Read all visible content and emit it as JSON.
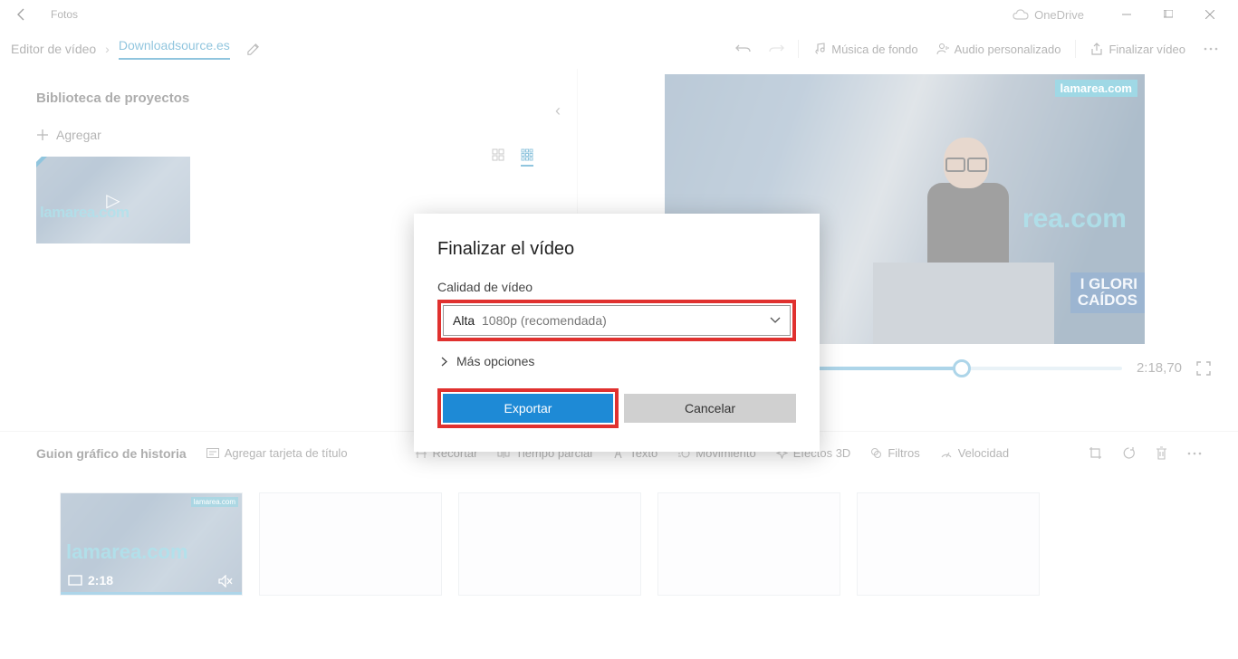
{
  "app_title": "Fotos",
  "onedrive": "OneDrive",
  "breadcrumb": {
    "root": "Editor de vídeo",
    "project": "Downloadsource.es"
  },
  "toolbar": {
    "bg_music": "Música de fondo",
    "custom_audio": "Audio personalizado",
    "finish": "Finalizar vídeo"
  },
  "sidebar": {
    "title": "Biblioteca de proyectos",
    "add": "Agregar",
    "watermark": "lamarea.com"
  },
  "preview": {
    "tag": "lamarea.com",
    "watermark": "rea.com",
    "banner_l1": "I GLORI",
    "banner_l2": "CAÍDOS",
    "time": "2:18,70"
  },
  "storyboard": {
    "title": "Guion gráfico de historia",
    "add_title": "Agregar tarjeta de título",
    "trim": "Recortar",
    "split": "Tiempo parcial",
    "text": "Texto",
    "motion": "Movimiento",
    "fx3d": "Efectos 3D",
    "filters": "Filtros",
    "speed": "Velocidad",
    "clip_watermark": "lamarea.com",
    "clip_time": "2:18"
  },
  "dialog": {
    "title": "Finalizar el vídeo",
    "quality_label": "Calidad de vídeo",
    "quality_prefix": "Alta",
    "quality_value": "1080p (recomendada)",
    "more": "Más opciones",
    "export": "Exportar",
    "cancel": "Cancelar"
  }
}
